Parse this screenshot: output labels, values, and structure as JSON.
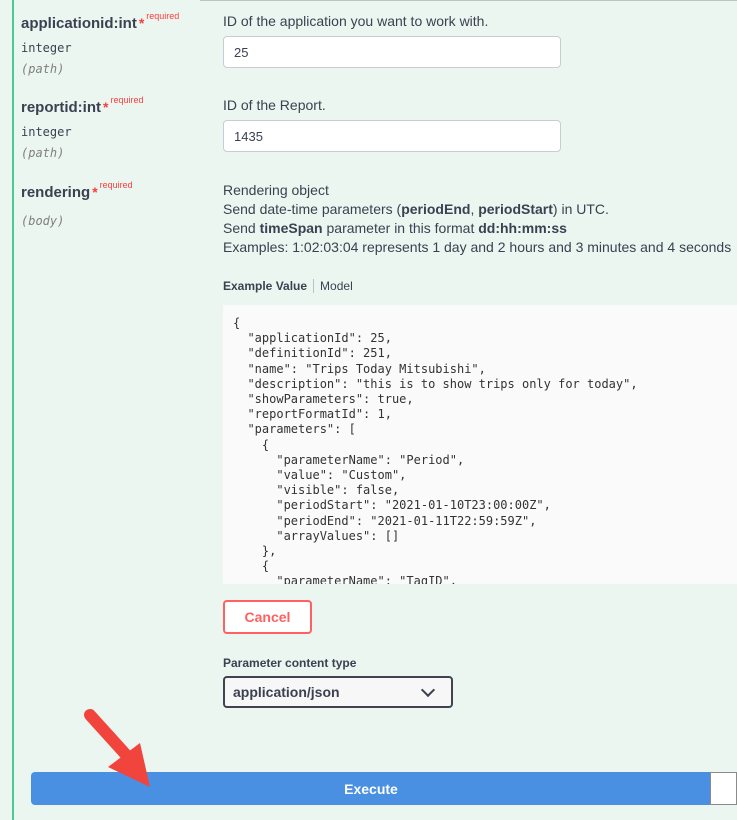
{
  "parameters": [
    {
      "name": "applicationid:int",
      "star": "*",
      "required": "required",
      "type": "integer",
      "in": "(path)",
      "description": "ID of the application you want to work with.",
      "value": "25"
    },
    {
      "name": "reportid:int",
      "star": "*",
      "required": "required",
      "type": "integer",
      "in": "(path)",
      "description": "ID of the Report.",
      "value": "1435"
    },
    {
      "name": "rendering",
      "star": "*",
      "required": "required",
      "in": "(body)"
    }
  ],
  "rendering_desc": {
    "line1": "Rendering object",
    "line2_pre": "Send date-time parameters (",
    "line2_b1": "periodEnd",
    "line2_mid": ", ",
    "line2_b2": "periodStart",
    "line2_post": ") in UTC.",
    "line3_pre": "Send ",
    "line3_b1": "timeSpan",
    "line3_mid": " parameter in this format ",
    "line3_b2": "dd:hh:mm:ss",
    "line4": "Examples: 1:02:03:04 represents 1 day and 2 hours and 3 minutes and 4 seconds"
  },
  "tabs": {
    "example_value": "Example Value",
    "model": "Model"
  },
  "example_json": "{\n  \"applicationId\": 25,\n  \"definitionId\": 251,\n  \"name\": \"Trips Today Mitsubishi\",\n  \"description\": \"this is to show trips only for today\",\n  \"showParameters\": true,\n  \"reportFormatId\": 1,\n  \"parameters\": [\n    {\n      \"parameterName\": \"Period\",\n      \"value\": \"Custom\",\n      \"visible\": false,\n      \"periodStart\": \"2021-01-10T23:00:00Z\",\n      \"periodEnd\": \"2021-01-11T22:59:59Z\",\n      \"arrayValues\": []\n    },\n    {\n      \"parameterName\": \"TagID\",",
  "cancel_label": "Cancel",
  "content_type": {
    "label": "Parameter content type",
    "selected": "application/json"
  },
  "execute_label": "Execute",
  "colors": {
    "accent_green": "#49cc90",
    "execute_blue": "#4990e2",
    "cancel_red": "#ff6060",
    "arrow_red": "#f0443c"
  }
}
